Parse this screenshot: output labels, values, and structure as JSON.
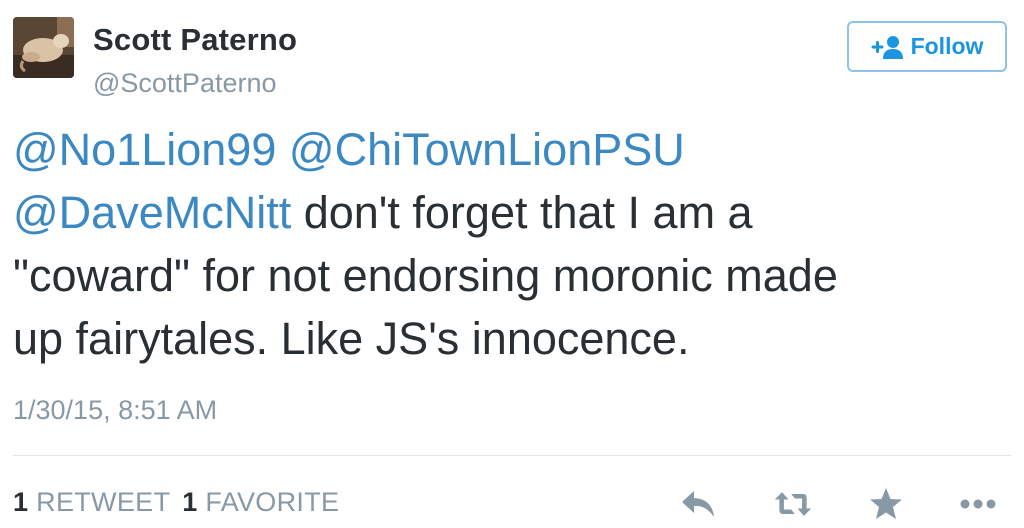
{
  "user": {
    "name": "Scott Paterno",
    "handle": "@ScottPaterno"
  },
  "follow_button": {
    "label": "Follow"
  },
  "tweet": {
    "mentions": [
      "@No1Lion99",
      "@ChiTownLionPSU",
      "@DaveMcNitt"
    ],
    "body_line1": " don't forget that I am a",
    "body_line2": "\"coward\" for not endorsing moronic made",
    "body_line3": "up fairytales. Like JS's innocence.",
    "timestamp": "1/30/15, 8:51 AM"
  },
  "stats": {
    "retweets_count": "1",
    "retweets_label": "RETWEET",
    "favorites_count": "1",
    "favorites_label": "FAVORITE"
  },
  "actions": [
    "reply-icon",
    "retweet-icon",
    "favorite-icon",
    "more-icon"
  ],
  "colors": {
    "link": "#3b88c3",
    "follow": "#1b95e0",
    "muted": "#8899a6",
    "text": "#292f33"
  }
}
